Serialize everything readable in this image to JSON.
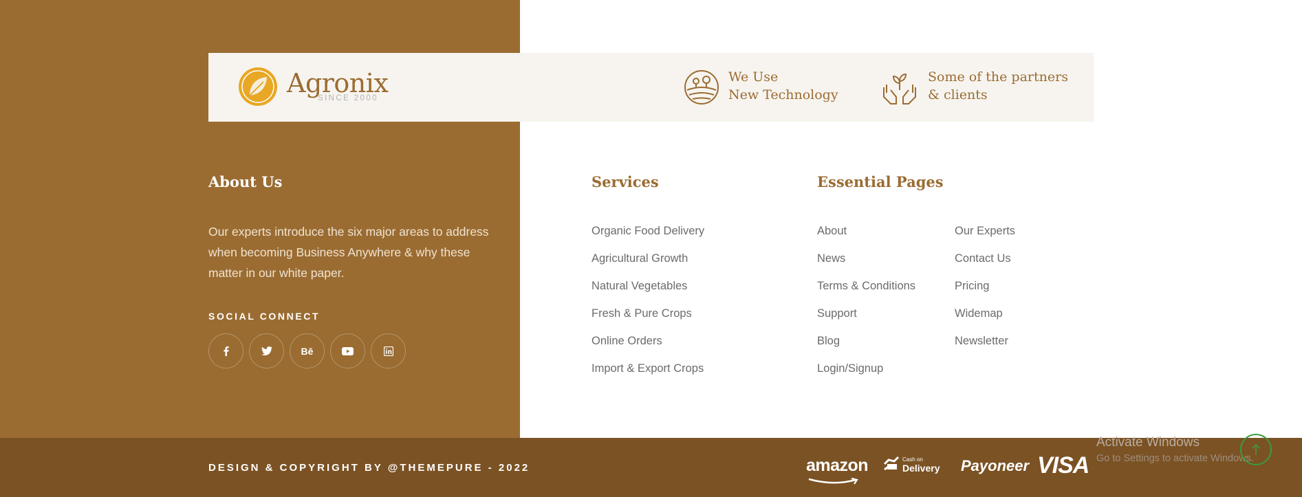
{
  "brand": {
    "name": "Agronix",
    "tagline": "SINCE 2000",
    "colors": {
      "primary": "#9a6c32",
      "panel": "#9a6c32",
      "bottom_bar": "#7b5224",
      "top_bar": "#f7f4ef",
      "accent_gold": "#e8a724"
    }
  },
  "features": [
    {
      "line1": "We Use",
      "line2": "New Technology",
      "icon": "farm-icon"
    },
    {
      "line1": "Some of the partners",
      "line2": "& clients",
      "icon": "plant-hands-icon"
    }
  ],
  "about": {
    "title": "About Us",
    "text": "Our experts introduce the six major areas to address when becoming Business Anywhere & why these matter in our white paper.",
    "social_title": "SOCIAL CONNECT",
    "social": [
      "facebook-icon",
      "twitter-icon",
      "behance-icon",
      "youtube-icon",
      "linkedin-icon"
    ],
    "behance_label": "Bē"
  },
  "services": {
    "title": "Services",
    "links": [
      "Organic Food Delivery",
      "Agricultural Growth",
      "Natural Vegetables",
      "Fresh & Pure Crops",
      "Online Orders",
      "Import & Export Crops"
    ]
  },
  "pages": {
    "title": "Essential Pages",
    "col1": [
      "About",
      "News",
      "Terms & Conditions",
      "Support",
      "Blog",
      "Login/Signup"
    ],
    "col2": [
      "Our Experts",
      "Contact Us",
      "Pricing",
      "Widemap",
      "Newsletter"
    ]
  },
  "footer": {
    "copyright": "DESIGN & COPYRIGHT BY @THEMEPURE - 2022",
    "payments": {
      "amazon": "amazon",
      "cod_small": "Cash on",
      "cod_big": "Delivery",
      "payoneer": "Payoneer",
      "visa": "VISA"
    }
  },
  "overlay": {
    "activate_title": "Activate Windows",
    "activate_sub": "Go to Settings to activate Windows."
  }
}
